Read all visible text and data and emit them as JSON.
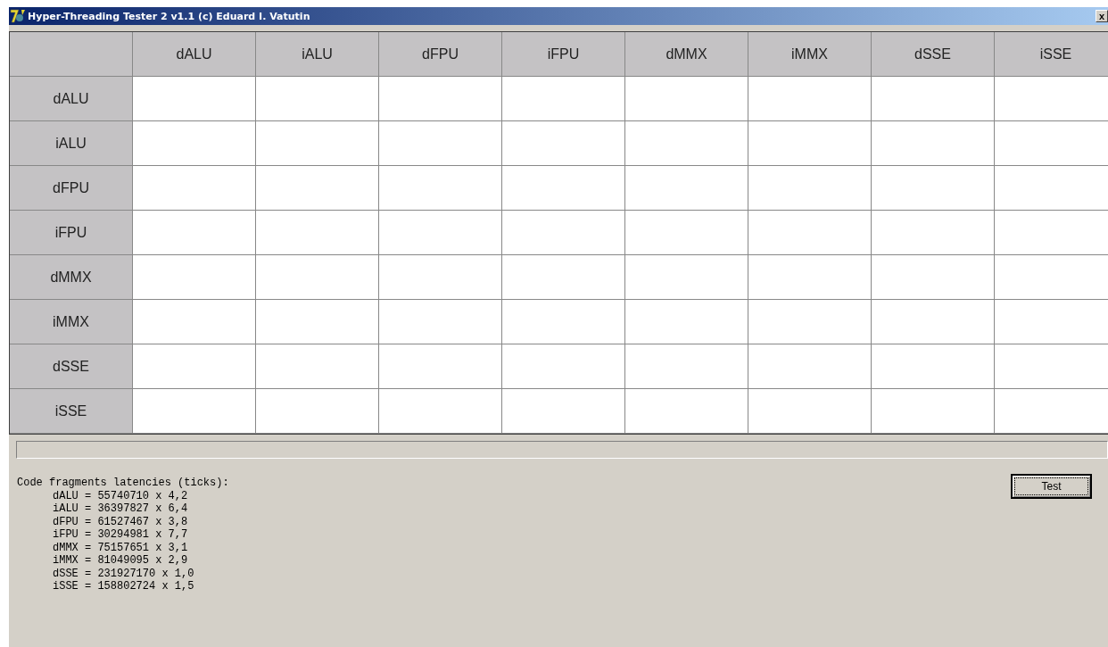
{
  "window": {
    "title": "Hyper-Threading Tester 2 v1.1 (c) Eduard I. Vatutin",
    "close": "x"
  },
  "table": {
    "columns": [
      "dALU",
      "iALU",
      "dFPU",
      "iFPU",
      "dMMX",
      "iMMX",
      "dSSE",
      "iSSE"
    ],
    "rows": [
      "dALU",
      "iALU",
      "dFPU",
      "iFPU",
      "dMMX",
      "iMMX",
      "dSSE",
      "iSSE"
    ]
  },
  "progress": {
    "level": 0
  },
  "output": {
    "heading": "Code fragments latencies (ticks):",
    "lines": [
      "dALU = 55740710 x 4,2",
      "iALU = 36397827 x 6,4",
      "dFPU = 61527467 x 3,8",
      "iFPU = 30294981 x 7,7",
      "dMMX = 75157651 x 3,1",
      "iMMX = 81049095 x 2,9",
      "dSSE = 231927170 x 1,0",
      "iSSE = 158802724 x 1,5"
    ]
  },
  "buttons": [
    {
      "label": "Test",
      "focused": true
    }
  ]
}
